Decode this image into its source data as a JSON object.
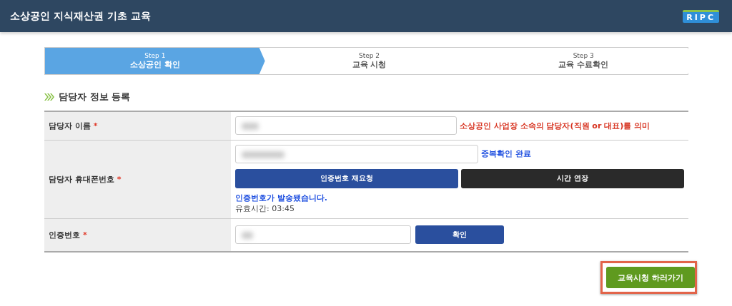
{
  "header": {
    "title": "소상공인 지식재산권 기초 교육",
    "logo": "RIPC"
  },
  "steps": [
    {
      "number": "Step 1",
      "label": "소상공인 확인",
      "selected": true
    },
    {
      "number": "Step 2",
      "label": "교육 시청",
      "selected": false
    },
    {
      "number": "Step 3",
      "label": "교육 수료확인",
      "selected": false
    }
  ],
  "section_title": "담당자 정보 등록",
  "form": {
    "rows": [
      {
        "label": "담당자 이름",
        "required": "*",
        "kind": "name",
        "note": "소상공인 사업장 소속의 담당자(직원 or 대표)를 의미"
      },
      {
        "label": "담당자 휴대폰번호",
        "required": "*",
        "kind": "phone",
        "status": "중복확인 완료",
        "buttons": [
          {
            "label": "인증번호 재요청",
            "kind": "primary"
          },
          {
            "label": "시간 연장",
            "kind": "dark"
          }
        ],
        "message": "인증번호가 발송됐습니다.",
        "timer": "유효시간: 03:45"
      },
      {
        "label": "인증번호",
        "required": "*",
        "kind": "code",
        "buttons": [
          {
            "label": "확인",
            "kind": "primary"
          }
        ]
      }
    ]
  },
  "submit": {
    "label": "교육시청 하러가기",
    "highlighted": true
  }
}
